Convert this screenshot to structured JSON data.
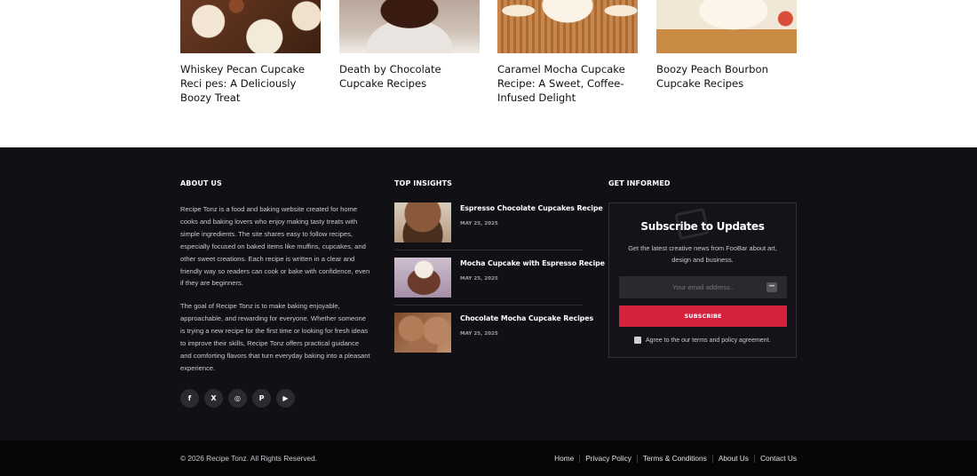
{
  "related": [
    {
      "title": "Whiskey Pecan Cupcake Reci pes: A Deliciously Boozy Treat"
    },
    {
      "title": "Death by Chocolate Cupcake Recipes"
    },
    {
      "title": "Caramel Mocha Cupcake Recipe: A Sweet, Coffee-Infused Delight"
    },
    {
      "title": "Boozy Peach Bourbon Cupcake Recipes"
    }
  ],
  "about": {
    "heading": "ABOUT US",
    "p1": "Recipe Tonz is a food and baking website created for home cooks and baking lovers who enjoy making tasty treats with simple ingredients. The site shares easy to follow recipes, especially focused on baked items like muffins, cupcakes, and other sweet creations. Each recipe is written in a clear and friendly way so readers can cook or bake with confidence, even if they are beginners.",
    "p2": "The goal of Recipe Tonz is to make baking enjoyable, approachable, and rewarding for everyone. Whether someone is trying a new recipe for the first time or looking for fresh ideas to improve their skills, Recipe Tonz offers practical guidance and comforting flavors that turn everyday baking into a pleasant experience."
  },
  "socials": [
    {
      "icon": "facebook-icon",
      "glyph": "f"
    },
    {
      "icon": "x-icon",
      "glyph": "X"
    },
    {
      "icon": "instagram-icon",
      "glyph": "◎"
    },
    {
      "icon": "pinterest-icon",
      "glyph": "P"
    },
    {
      "icon": "youtube-icon",
      "glyph": "▶"
    }
  ],
  "insights": {
    "heading": "TOP INSIGHTS",
    "items": [
      {
        "title": "Espresso Chocolate Cupcakes Recipe",
        "date": "MAY 25, 2025"
      },
      {
        "title": "Mocha Cupcake with Espresso Recipe",
        "date": "MAY 25, 2025"
      },
      {
        "title": "Chocolate Mocha Cupcake Recipes",
        "date": "MAY 25, 2025"
      }
    ]
  },
  "informed": {
    "heading": "GET INFORMED",
    "title": "Subscribe to Updates",
    "desc": "Get the latest creative news from FooBar about art, design and business.",
    "placeholder": "Your email address..",
    "button": "SUBSCRIBE",
    "agree": "Agree to the our terms and policy agreement."
  },
  "bottom": {
    "copyright": "© 2026 Recipe Tonz. All Rights Reserved.",
    "links": [
      "Home",
      "Privacy Policy",
      "Terms & Conditions",
      "About Us",
      "Contact Us"
    ]
  },
  "colors": {
    "footer_bg": "#111014",
    "bottom_bg": "#060607",
    "accent": "#d6213c"
  }
}
